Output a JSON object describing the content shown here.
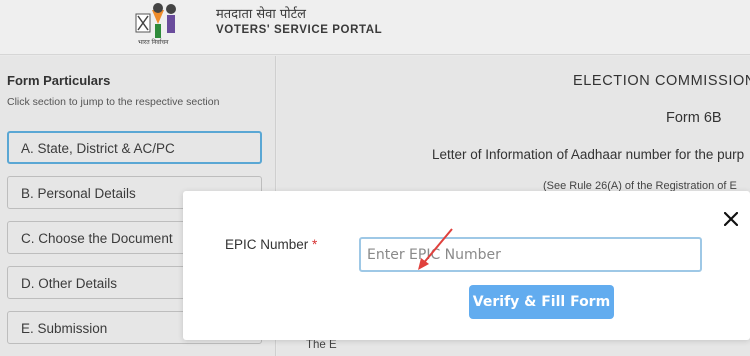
{
  "header": {
    "portal_name_hindi": "मतदाता सेवा पोर्टल",
    "portal_name_english": "VOTERS' SERVICE PORTAL"
  },
  "sidebar": {
    "title": "Form Particulars",
    "hint": "Click section to jump to the respective section",
    "sections": [
      {
        "label": "A. State, District & AC/PC",
        "active": true
      },
      {
        "label": "B. Personal Details",
        "active": false
      },
      {
        "label": "C. Choose the Document",
        "active": false
      },
      {
        "label": "D. Other Details",
        "active": false
      },
      {
        "label": "E. Submission",
        "active": false
      }
    ]
  },
  "main": {
    "title": "ELECTION  COMMISSION",
    "form_name": "Form 6B",
    "letter": "Letter of Information of Aadhaar number for the purp",
    "rule": "(See Rule 26(A) of the Registration of E",
    "fragment": "The E"
  },
  "modal": {
    "epic_label": "EPIC Number",
    "required_mark": "*",
    "epic_placeholder": "Enter EPIC Number",
    "verify_button": "Verify & Fill Form",
    "close_icon": "close-icon"
  },
  "colors": {
    "accent_button": "#62acef",
    "active_border": "#5aa7d4",
    "annotation_arrow": "#e0403c"
  }
}
